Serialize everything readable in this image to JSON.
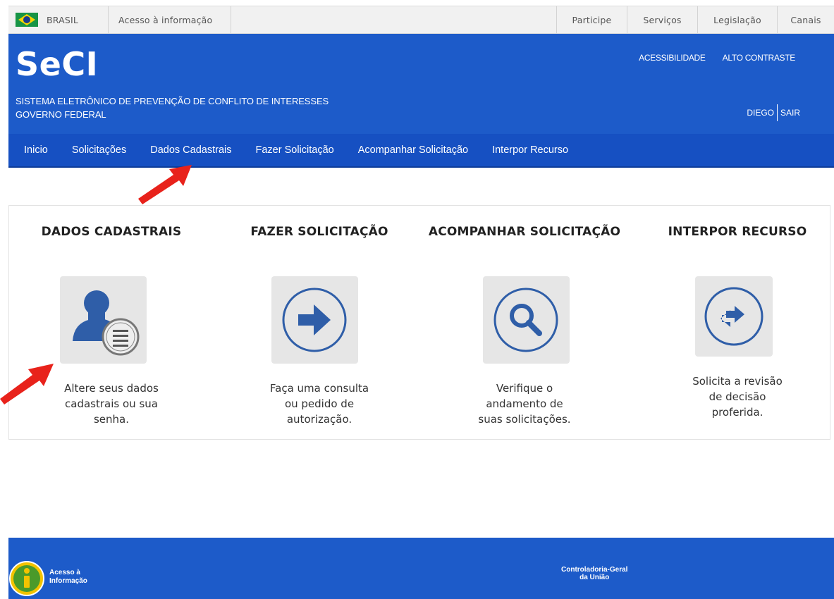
{
  "govbar": {
    "country": "BRASIL",
    "access_info": "Acesso à informação",
    "links": [
      "Participe",
      "Serviços",
      "Legislação",
      "Canais"
    ]
  },
  "header": {
    "logo": "SeCI",
    "subtitle_line1": "SISTEMA ELETRÔNICO DE PREVENÇÃO DE CONFLITO DE INTERESSES",
    "subtitle_line2": "GOVERNO FEDERAL",
    "accessibility": "ACESSIBILIDADE",
    "high_contrast": "ALTO CONTRASTE",
    "user_name": "DIEGO",
    "logout": "SAIR"
  },
  "nav": {
    "items": [
      "Inicio",
      "Solicitações",
      "Dados Cadastrais",
      "Fazer Solicitação",
      "Acompanhar Solicitação",
      "Interpor Recurso"
    ]
  },
  "cards": [
    {
      "title": "DADOS CADASTRAIS",
      "icon": "user-list-icon",
      "desc1": "Altere seus dados",
      "desc2": "cadastrais ou sua",
      "desc3": "senha."
    },
    {
      "title": "FAZER SOLICITAÇÃO",
      "icon": "arrow-right-circle-icon",
      "desc1": "Faça uma consulta",
      "desc2": "ou pedido de",
      "desc3": "autorização."
    },
    {
      "title": "ACOMPANHAR SOLICITAÇÃO",
      "icon": "search-circle-icon",
      "desc1": "Verifique o",
      "desc2": "andamento de",
      "desc3": "suas solicitações."
    },
    {
      "title": "INTERPOR RECURSO",
      "icon": "swap-arrows-circle-icon",
      "desc1": "Solicita a revisão",
      "desc2": "de decisão",
      "desc3": "proferida."
    }
  ],
  "footer": {
    "access_line1": "Acesso à",
    "access_line2": "Informação",
    "cgu_line1": "Controladoria-Geral",
    "cgu_line2": "da União"
  },
  "colors": {
    "header_blue": "#1d5bc9",
    "nav_blue": "#1650c2",
    "icon_blue": "#2f5ea8",
    "annotation_red": "#e8221b"
  }
}
